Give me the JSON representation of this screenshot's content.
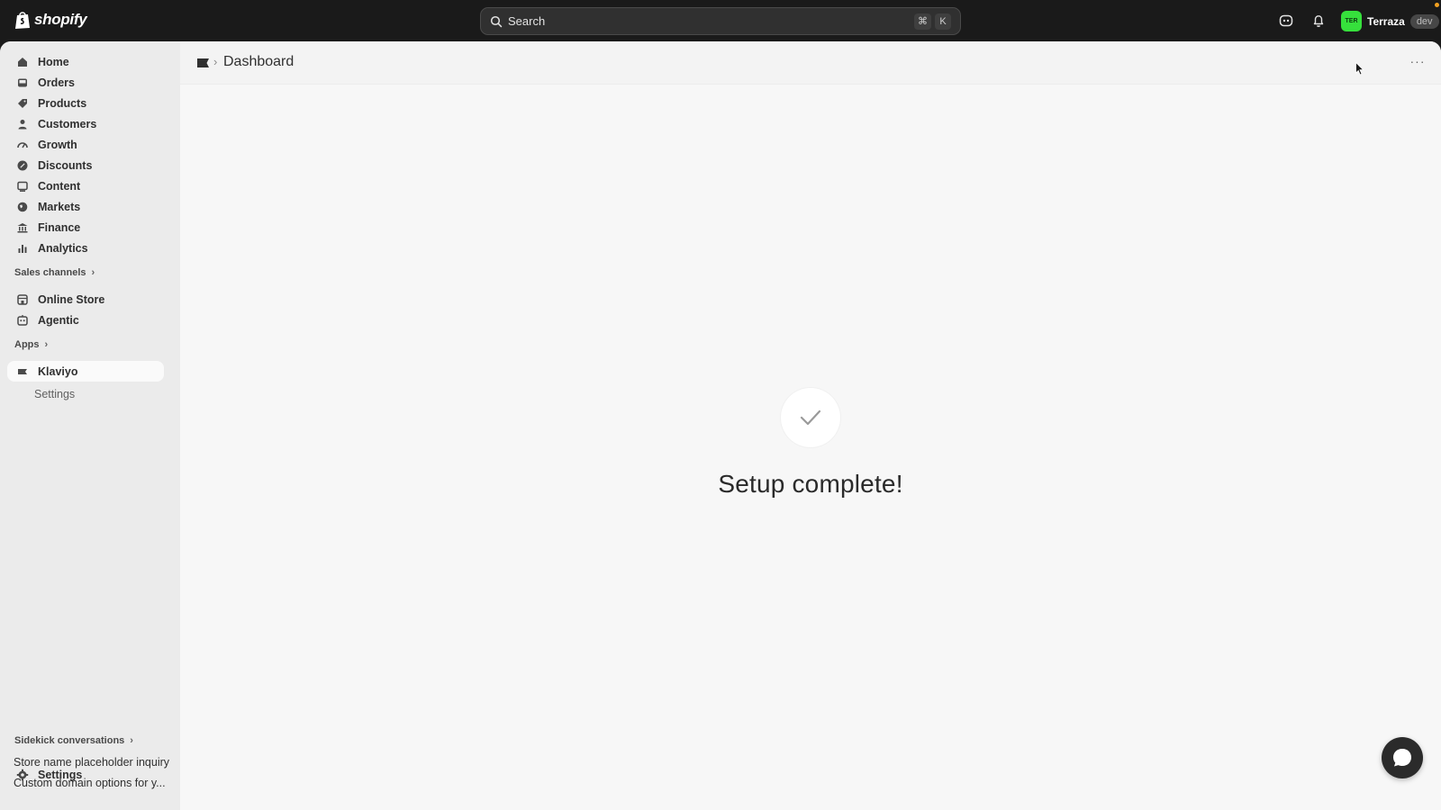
{
  "topbar": {
    "logo_text": "shopify",
    "search_placeholder": "Search",
    "shortcut_keys": [
      "⌘",
      "K"
    ],
    "store": {
      "avatar_initials": "TER",
      "name": "Terraza",
      "badge": "dev"
    }
  },
  "sidebar": {
    "items": [
      {
        "label": "Home",
        "icon": "home-icon"
      },
      {
        "label": "Orders",
        "icon": "inbox-icon"
      },
      {
        "label": "Products",
        "icon": "tag-icon"
      },
      {
        "label": "Customers",
        "icon": "person-icon"
      },
      {
        "label": "Growth",
        "icon": "gauge-icon"
      },
      {
        "label": "Discounts",
        "icon": "discount-icon"
      },
      {
        "label": "Content",
        "icon": "content-icon"
      },
      {
        "label": "Markets",
        "icon": "globe-icon"
      },
      {
        "label": "Finance",
        "icon": "bank-icon"
      },
      {
        "label": "Analytics",
        "icon": "bar-chart-icon"
      }
    ],
    "sales_channels_label": "Sales channels",
    "sales_channels": [
      {
        "label": "Online Store",
        "icon": "store-icon"
      },
      {
        "label": "Agentic",
        "icon": "robot-icon"
      }
    ],
    "apps_label": "Apps",
    "apps": [
      {
        "label": "Klaviyo",
        "icon": "klaviyo-flag-icon",
        "active": true
      }
    ],
    "app_sub_items": [
      "Settings"
    ],
    "sidekick_label": "Sidekick conversations",
    "conversations": [
      "Store name placeholder inquiry",
      "Custom domain options for y..."
    ],
    "settings_label": "Settings"
  },
  "main": {
    "breadcrumb_separator": "›",
    "title": "Dashboard",
    "more_label": "···",
    "status_message": "Setup complete!"
  },
  "colors": {
    "topbar_bg": "#1a1a1a",
    "sidebar_bg": "#ebebeb",
    "main_bg": "#f7f7f7",
    "avatar_bg": "#36e03c"
  }
}
